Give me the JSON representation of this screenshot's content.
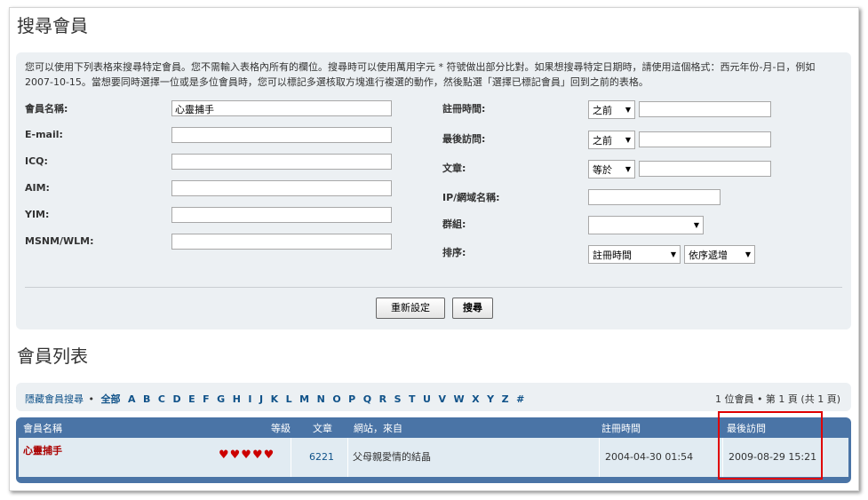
{
  "page_title": "搜尋會員",
  "intro_text": "您可以使用下列表格來搜尋特定會員。您不需輸入表格內所有的欄位。搜尋時可以使用萬用字元 * 符號做出部分比對。如果想搜尋特定日期時，請使用這個格式：西元年份-月-日，例如 2007-10-15。當想要同時選擇一位或是多位會員時，您可以標記多選核取方塊進行複選的動作，然後點選「選擇已標記會員」回到之前的表格。",
  "form": {
    "username_label": "會員名稱:",
    "username_value": "心靈捕手",
    "email_label": "E-mail:",
    "icq_label": "ICQ:",
    "aim_label": "AIM:",
    "yim_label": "YIM:",
    "msnm_label": "MSNM/WLM:",
    "joined_label": "註冊時間:",
    "joined_select": "之前",
    "lastvisit_label": "最後訪問:",
    "lastvisit_select": "之前",
    "posts_label": "文章:",
    "posts_select": "等於",
    "ip_label": "IP/網域名稱:",
    "group_label": "群組:",
    "group_select": "",
    "sort_label": "排序:",
    "sort_key_select": "註冊時間",
    "sort_dir_select": "依序遞增",
    "reset_button": "重新設定",
    "search_button": "搜尋"
  },
  "list_title": "會員列表",
  "alpha": {
    "hide_link": "隱藏會員搜尋",
    "bullet": "•",
    "all_link": "全部",
    "letters": [
      "A",
      "B",
      "C",
      "D",
      "E",
      "F",
      "G",
      "H",
      "I",
      "J",
      "K",
      "L",
      "M",
      "N",
      "O",
      "P",
      "Q",
      "R",
      "S",
      "T",
      "U",
      "V",
      "W",
      "X",
      "Y",
      "Z",
      "#"
    ]
  },
  "pagination_text": "1 位會員 • 第 1 頁 (共 1 頁)",
  "table": {
    "headers": {
      "username": "會員名稱",
      "rank": "等級",
      "posts": "文章",
      "website": "網站，來自",
      "joined": "註冊時間",
      "lastvisit": "最後訪問"
    },
    "rows": [
      {
        "username": "心靈捕手",
        "rank_hearts": "♥♥♥♥♥",
        "posts": "6221",
        "website": "父母親愛情的結晶",
        "joined": "2004-04-30 01:54",
        "lastvisit": "2009-08-29 15:21"
      }
    ]
  },
  "colors": {
    "panel_bg": "#ecf0f3",
    "table_header_bg": "#4a74a6",
    "row_bg": "#e1ebf2",
    "username_color": "#aa0000",
    "link_color": "#105289",
    "highlight_border": "#e00000"
  },
  "icons": {
    "dropdown": "chevron-down-icon",
    "rank": "heart-icon"
  }
}
